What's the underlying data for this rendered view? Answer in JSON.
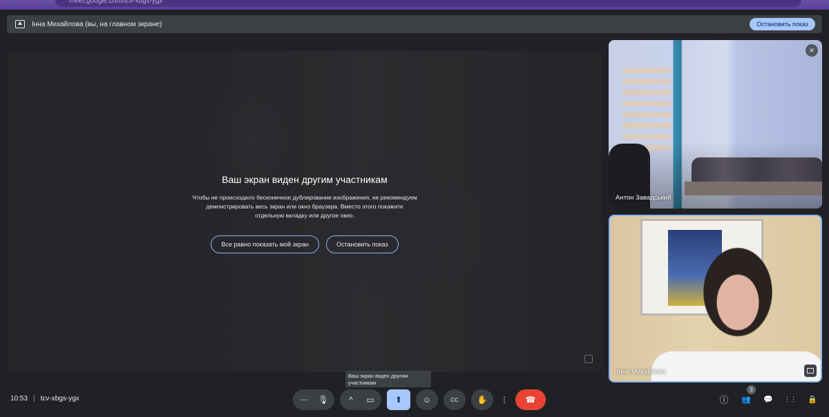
{
  "browser": {
    "url_fragment": "meet.google.com/tcv-xbgs-ygx"
  },
  "share_bar": {
    "presenter_text": "Інна Михайлова (вы, на главном экране)",
    "stop_button": "Остановить показ"
  },
  "main_stage": {
    "notice_title": "Ваш экран виден другим участникам",
    "notice_body": "Чтобы не происходило бесконечное дублирование изображения, не рекомендуем демонстрировать весь экран или окно браузера. Вместо этого покажите отдельную вкладку или другое окно.",
    "show_anyway_button": "Все равно показать мой экран",
    "stop_sharing_button": "Остановить показ"
  },
  "participants": [
    {
      "name": "Антон Завадський",
      "muted": true
    },
    {
      "name": "Інна Михайлова",
      "muted": false
    }
  ],
  "tooltip": "Ваш экран виден другим участникам",
  "meeting": {
    "time": "10:53",
    "separator": "|",
    "code": "tcv-xbgs-ygx"
  },
  "controls": {
    "more_audio": "⋯",
    "mic_icon": "🎙",
    "expand_video": "^",
    "camera_icon": "▭",
    "present_icon": "⬆",
    "emoji_icon": "☺",
    "captions_icon": "CC",
    "hand_icon": "✋",
    "more_icon": "⋮",
    "hangup_icon": "☎"
  },
  "right_controls": {
    "info_icon": "ⓘ",
    "people_icon": "👥",
    "people_count": "3",
    "chat_icon": "💬",
    "activities_icon": "⋮⋮",
    "lock_icon": "🔒"
  }
}
